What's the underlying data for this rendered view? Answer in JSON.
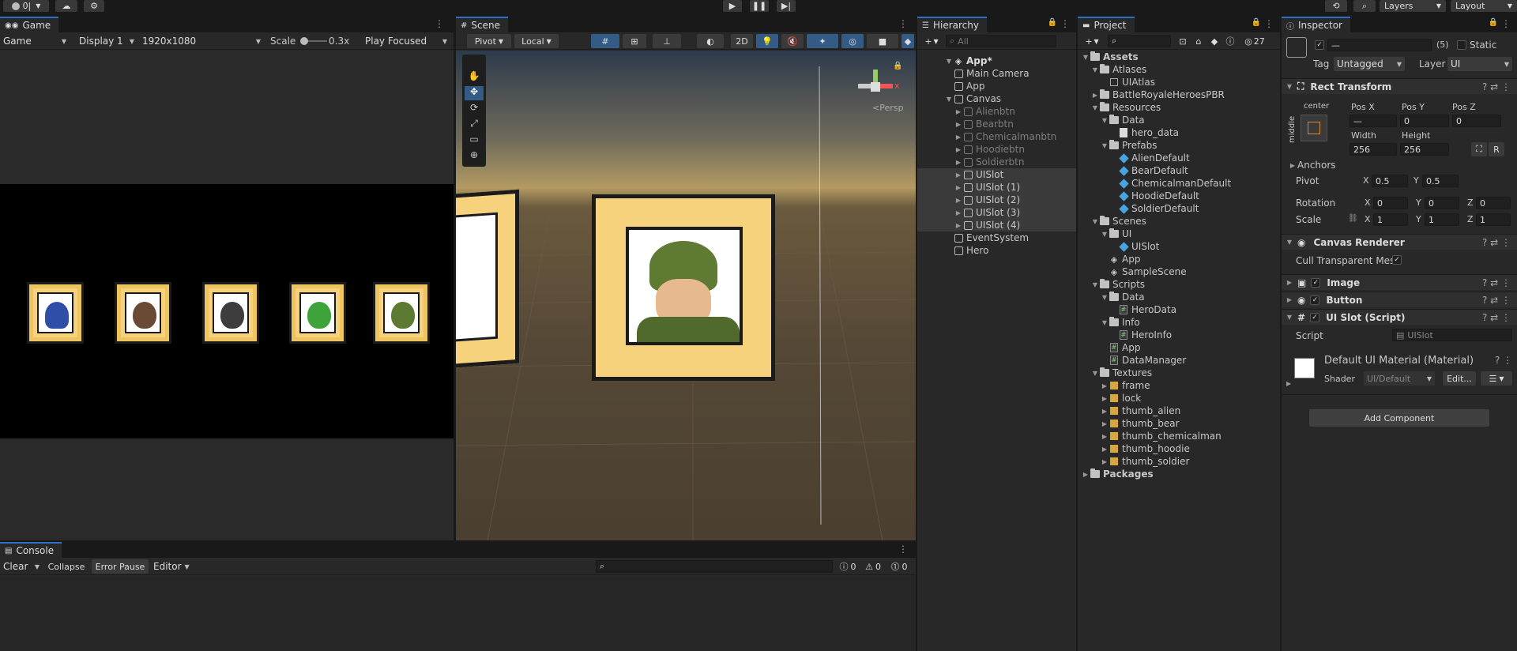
{
  "topbar": {
    "account_label": "0|",
    "layers_label": "Layers",
    "layout_label": "Layout"
  },
  "game": {
    "tab": "Game",
    "view_mode": "Game",
    "display": "Display 1",
    "resolution": "1920x1080",
    "scale_label": "Scale",
    "scale_value": "0.3x",
    "focus": "Play Focused"
  },
  "scene": {
    "tab": "Scene",
    "pivot": "Pivot",
    "local": "Local",
    "mode_2d": "2D",
    "persp": "<Persp",
    "gizmo_y": "y",
    "gizmo_x": "x"
  },
  "hierarchy": {
    "tab": "Hierarchy",
    "search_placeholder": "All",
    "root": "App*",
    "items": [
      {
        "label": "Main Camera",
        "indent": 1
      },
      {
        "label": "App",
        "indent": 1
      },
      {
        "label": "Canvas",
        "indent": 1
      },
      {
        "label": "Alienbtn",
        "indent": 2
      },
      {
        "label": "Bearbtn",
        "indent": 2
      },
      {
        "label": "Chemicalmanbtn",
        "indent": 2
      },
      {
        "label": "Hoodiebtn",
        "indent": 2
      },
      {
        "label": "Soldierbtn",
        "indent": 2
      },
      {
        "label": "UISlot",
        "indent": 2
      },
      {
        "label": "UISlot (1)",
        "indent": 2
      },
      {
        "label": "UISlot (2)",
        "indent": 2
      },
      {
        "label": "UISlot (3)",
        "indent": 2
      },
      {
        "label": "UISlot (4)",
        "indent": 2
      },
      {
        "label": "EventSystem",
        "indent": 1
      },
      {
        "label": "Hero",
        "indent": 1
      }
    ]
  },
  "project": {
    "tab": "Project",
    "hidden_count": "27",
    "items": [
      {
        "label": "Assets",
        "indent": 0
      },
      {
        "label": "Atlases",
        "indent": 1
      },
      {
        "label": "UIAtlas",
        "indent": 2
      },
      {
        "label": "BattleRoyaleHeroesPBR",
        "indent": 1
      },
      {
        "label": "Resources",
        "indent": 1
      },
      {
        "label": "Data",
        "indent": 2
      },
      {
        "label": "hero_data",
        "indent": 3
      },
      {
        "label": "Prefabs",
        "indent": 2
      },
      {
        "label": "AlienDefault",
        "indent": 3
      },
      {
        "label": "BearDefault",
        "indent": 3
      },
      {
        "label": "ChemicalmanDefault",
        "indent": 3
      },
      {
        "label": "HoodieDefault",
        "indent": 3
      },
      {
        "label": "SoldierDefault",
        "indent": 3
      },
      {
        "label": "Scenes",
        "indent": 1
      },
      {
        "label": "UI",
        "indent": 2
      },
      {
        "label": "UISlot",
        "indent": 3
      },
      {
        "label": "App",
        "indent": 2
      },
      {
        "label": "SampleScene",
        "indent": 2
      },
      {
        "label": "Scripts",
        "indent": 1
      },
      {
        "label": "Data",
        "indent": 2
      },
      {
        "label": "HeroData",
        "indent": 3
      },
      {
        "label": "Info",
        "indent": 2
      },
      {
        "label": "HeroInfo",
        "indent": 3
      },
      {
        "label": "App",
        "indent": 2
      },
      {
        "label": "DataManager",
        "indent": 2
      },
      {
        "label": "Textures",
        "indent": 1
      },
      {
        "label": "frame",
        "indent": 2
      },
      {
        "label": "lock",
        "indent": 2
      },
      {
        "label": "thumb_alien",
        "indent": 2
      },
      {
        "label": "thumb_bear",
        "indent": 2
      },
      {
        "label": "thumb_chemicalman",
        "indent": 2
      },
      {
        "label": "thumb_hoodie",
        "indent": 2
      },
      {
        "label": "thumb_soldier",
        "indent": 2
      },
      {
        "label": "Packages",
        "indent": 0
      }
    ]
  },
  "inspector": {
    "tab": "Inspector",
    "object_name": "—",
    "count": "(5)",
    "static_label": "Static",
    "tag_label": "Tag",
    "tag_value": "Untagged",
    "layer_label": "Layer",
    "layer_value": "UI",
    "rect_transform": "Rect Transform",
    "anchor_h": "center",
    "anchor_v": "middle",
    "pos_x_label": "Pos X",
    "pos_y_label": "Pos Y",
    "pos_z_label": "Pos Z",
    "pos_x": "—",
    "pos_y": "0",
    "pos_z": "0",
    "width_label": "Width",
    "height_label": "Height",
    "width": "256",
    "height": "256",
    "r_button": "R",
    "anchors": "Anchors",
    "pivot_label": "Pivot",
    "pivot_x": "0.5",
    "pivot_y": "0.5",
    "rotation_label": "Rotation",
    "rot_x": "0",
    "rot_y": "0",
    "rot_z": "0",
    "scale_label": "Scale",
    "scale_x": "1",
    "scale_y": "1",
    "scale_z": "1",
    "x": "X",
    "y": "Y",
    "z": "Z",
    "canvas_renderer": "Canvas Renderer",
    "cull_label": "Cull Transparent Mes",
    "image": "Image",
    "button": "Button",
    "ui_slot_script": "UI Slot (Script)",
    "script_label": "Script",
    "script_value": "UISlot",
    "material_name": "Default UI Material (Material)",
    "shader_label": "Shader",
    "shader_value": "UI/Default",
    "edit_button": "Edit...",
    "add_component": "Add Component"
  },
  "console": {
    "tab": "Console",
    "clear": "Clear",
    "collapse": "Collapse",
    "error_pause": "Error Pause",
    "editor": "Editor",
    "log_count": "0",
    "warn_count": "0",
    "error_count": "0"
  },
  "colors": {
    "accent": "#2d6fc4",
    "panel": "#282828",
    "frame_gold": "#f6d27c"
  }
}
